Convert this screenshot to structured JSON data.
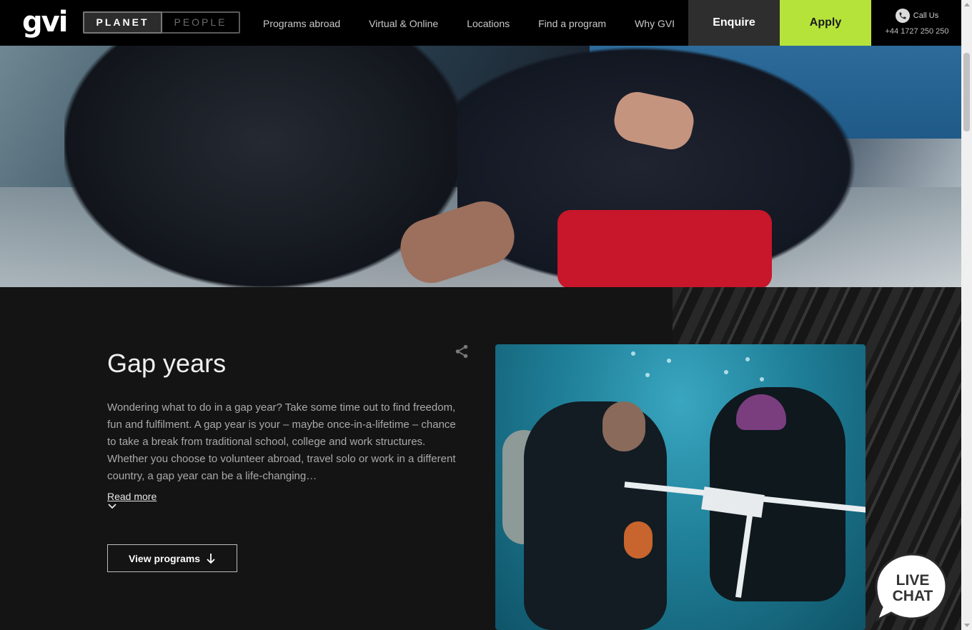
{
  "header": {
    "logo_text": "gvi",
    "toggle": {
      "active": "PLANET",
      "inactive": "PEOPLE"
    },
    "nav": [
      "Programs abroad",
      "Virtual & Online",
      "Locations",
      "Find a program",
      "Why GVI"
    ],
    "enquire_label": "Enquire",
    "apply_label": "Apply",
    "call_label": "Call Us",
    "phone_number": "+44 1727 250 250",
    "accent_color": "#b6e33a"
  },
  "section": {
    "title": "Gap years",
    "description": "Wondering what to do in a gap year? Take some time out to find freedom, fun and fulfilment. A gap year is your – maybe once-in-a-lifetime – chance to take a break from traditional school, college and work structures. Whether you choose to volunteer abroad, travel solo or work in a different country, a gap year can be a life-changing…",
    "read_more_label": "Read more",
    "view_programs_label": "View programs"
  },
  "live_chat": {
    "line1": "LIVE",
    "line2": "CHAT"
  }
}
